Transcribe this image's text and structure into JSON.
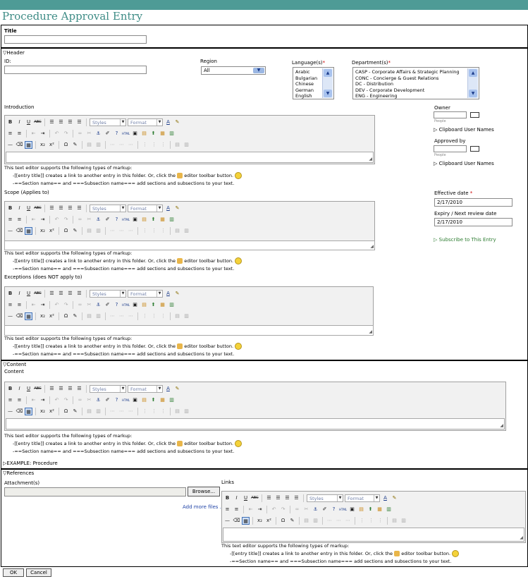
{
  "page": {
    "title": "Procedure Approval Entry"
  },
  "title_section": {
    "label": "Title",
    "value": ""
  },
  "header": {
    "section_label": "Header",
    "id_label": "ID:",
    "region_label": "Region",
    "region_value": "All",
    "languages_label": "Language(s)",
    "languages": [
      "Arabic",
      "Bulgarian",
      "Chinese",
      "German",
      "English"
    ],
    "departments_label": "Department(s)",
    "departments": [
      "CASP - Corporate Affairs & Strategic Planning",
      "CONC - Concierge & Guest Relations",
      "DC - Distribution",
      "DEV - Corporate Development",
      "ENG - Engineering"
    ],
    "introduction_label": "Introduction",
    "scope_label": "Scope (Applies to)",
    "exceptions_label": "Exceptions (does NOT apply to)",
    "owner_label": "Owner",
    "people_hint": "People",
    "clipboard_label": "Clipboard User Names",
    "approved_by_label": "Approved by",
    "effective_date_label": "Effective date",
    "effective_date_value": "2/17/2010",
    "expiry_label": "Expiry / Next review date",
    "expiry_value": "2/17/2010",
    "subscribe_label": "Subscribe to This Entry"
  },
  "toolbar": {
    "bold": "B",
    "italic": "I",
    "underline": "U",
    "strike": "ABC",
    "styles": "Styles",
    "format": "Format",
    "font_color": "A",
    "subscript": "x₂",
    "superscript": "x²",
    "omega": "Ω",
    "html": "HTML"
  },
  "markup_help": {
    "line1": "This text editor supports the following types of markup:",
    "line2a": "-[[entry title]] creates a link to another entry in this folder. Or, click the",
    "line2b": "editor toolbar button.",
    "line3": "-==Section name== and ===Subsection name=== add sections and subsections to your text."
  },
  "content": {
    "section_label": "Content",
    "content_label": "Content",
    "example_label": "EXAMPLE: Procedure"
  },
  "references": {
    "section_label": "References",
    "attachments_label": "Attachment(s)",
    "browse_label": "Browse...",
    "add_more_label": "Add more files ...",
    "links_label": "Links"
  },
  "footer": {
    "ok_label": "OK",
    "cancel_label": "Cancel"
  },
  "colors": {
    "topbar": "#4e9b96",
    "title": "#3f8c86",
    "link": "#2346a8",
    "required": "#cc0000"
  }
}
